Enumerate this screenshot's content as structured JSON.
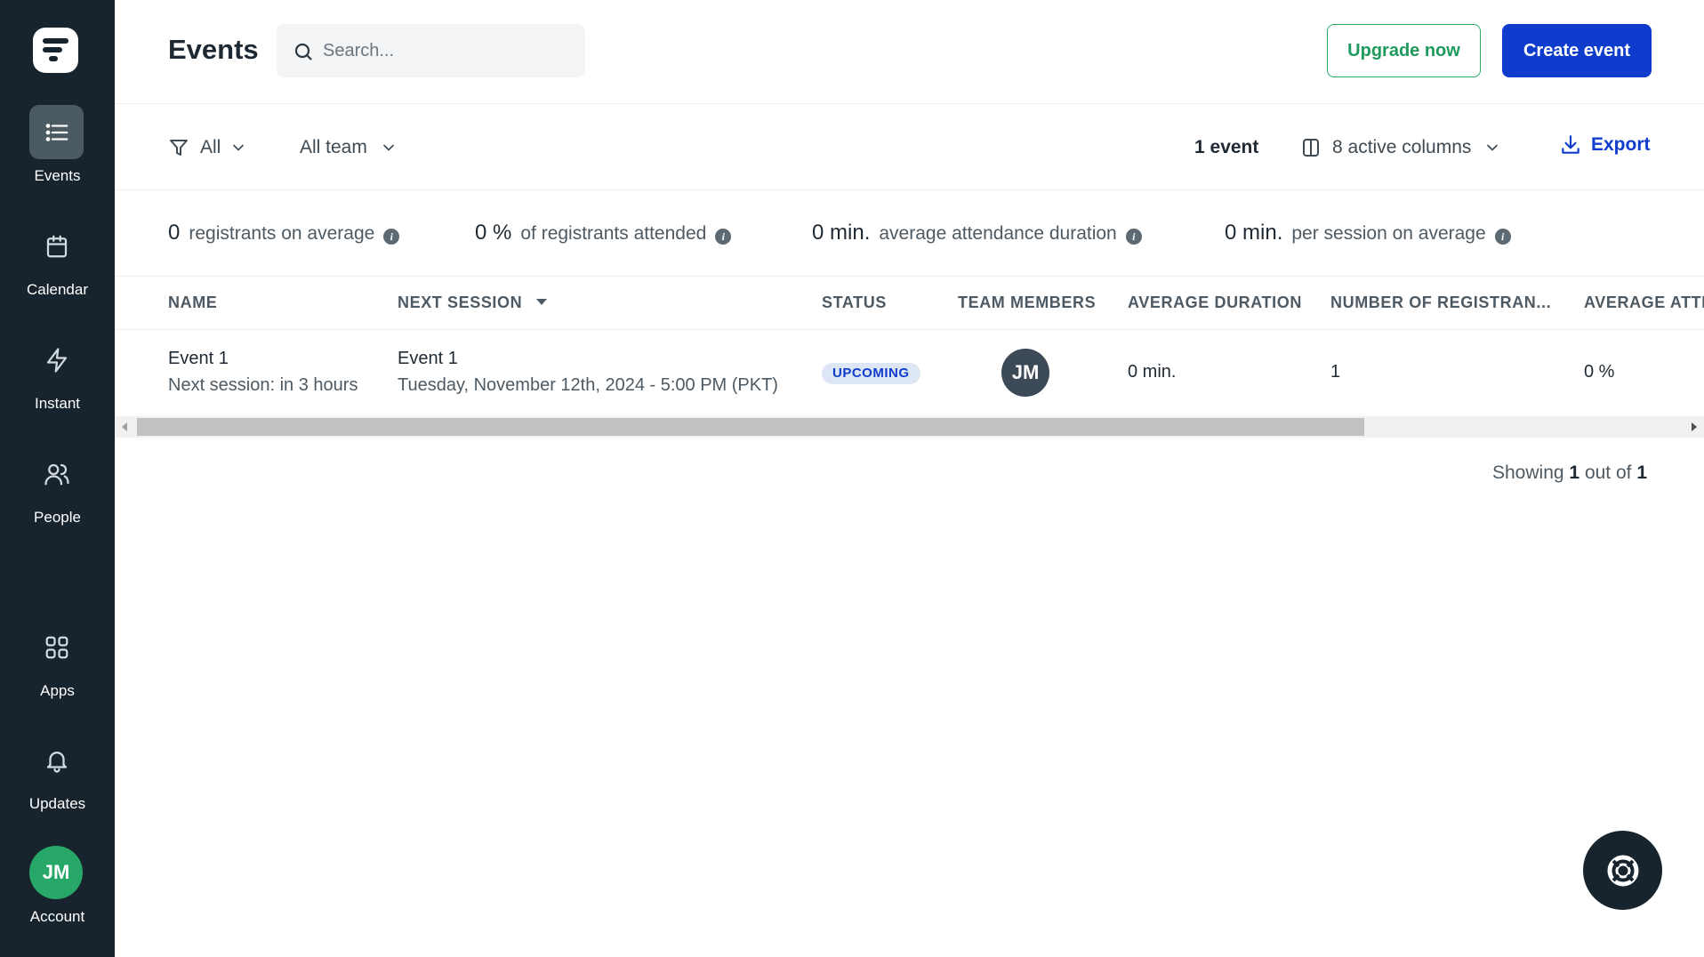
{
  "sidebar": {
    "items": [
      {
        "label": "Events",
        "icon": "list-icon",
        "active": true
      },
      {
        "label": "Calendar",
        "icon": "calendar-icon"
      },
      {
        "label": "Instant",
        "icon": "lightning-icon"
      },
      {
        "label": "People",
        "icon": "people-icon"
      },
      {
        "label": "Apps",
        "icon": "apps-grid-icon"
      },
      {
        "label": "Updates",
        "icon": "bell-icon"
      }
    ],
    "account": {
      "initials": "JM",
      "label": "Account",
      "color": "#27a869"
    }
  },
  "header": {
    "title": "Events",
    "search_placeholder": "Search...",
    "upgrade_label": "Upgrade now",
    "create_label": "Create event"
  },
  "filters": {
    "type": "All",
    "team": "All team",
    "count": "1 event",
    "columns": "8 active columns",
    "export": "Export"
  },
  "stats": [
    {
      "value": "0",
      "label": "registrants on average"
    },
    {
      "value": "0 %",
      "label": "of registrants attended"
    },
    {
      "value": "0 min.",
      "label": "average attendance duration"
    },
    {
      "value": "0 min.",
      "label": "per session on average"
    }
  ],
  "table": {
    "columns": [
      "NAME",
      "NEXT SESSION",
      "STATUS",
      "TEAM MEMBERS",
      "AVERAGE DURATION",
      "NUMBER OF REGISTRAN...",
      "AVERAGE ATTE"
    ],
    "rows": [
      {
        "name": "Event 1",
        "name_sub": "Next session: in 3 hours",
        "session": "Event 1",
        "session_sub": "Tuesday, November 12th, 2024 - 5:00 PM (PKT)",
        "status": "UPCOMING",
        "member_initials": "JM",
        "avg_duration": "0 min.",
        "registrants": "1",
        "avg_attendance": "0 %"
      }
    ]
  },
  "pagination": {
    "prefix": "Showing",
    "shown": "1",
    "middle": "out of",
    "total": "1"
  },
  "colors": {
    "sidebar": "#17242d",
    "primary": "#0f3ccc",
    "accent_green": "#27a869"
  }
}
